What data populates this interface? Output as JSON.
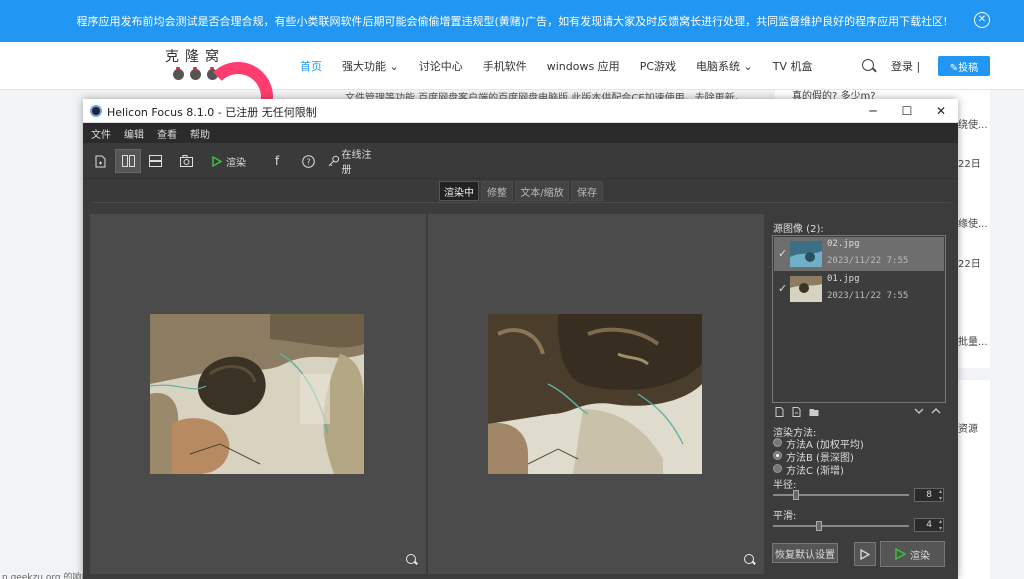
{
  "site": {
    "notice_text": "程序应用发布前均会测试是否合理合规，有些小类联网软件后期可能会偷偷增置违规型(黄赌)广告，如有发现请大家及时反馈窝长进行处理，共同监督维护良好的程序应用下载社区!",
    "logo_text": "克隆窝",
    "nav": [
      "首页",
      "强大功能 ⌄",
      "讨论中心",
      "手机软件",
      "windows 应用",
      "PC游戏",
      "电脑系统 ⌄",
      "TV 机盒"
    ],
    "login": "登录",
    "post": "✎投稿",
    "article_snippet": "文件管理等功能.百度网盘客户端的百度网盘电脑版,此版本供配合CE加速使用，去除更新。...",
    "right_question": "真的假的? 多少m?",
    "right_frag1": "绕使...",
    "right_frag2": "22日",
    "right_frag3": "缘使...",
    "right_frag4": "22日",
    "right_frag5": "批量...",
    "right_frag6": "资源",
    "bottom_url": "n.geekzu.org 的响应"
  },
  "window": {
    "title": "Helicon Focus 8.1.0 - 已注册  无任何限制",
    "menu": [
      "文件",
      "编辑",
      "查看",
      "帮助"
    ],
    "toolbar": {
      "render_label": "渲染",
      "register_label": "在线注册"
    },
    "tabs": [
      "渲染中",
      "修整",
      "文本/缩放",
      "保存"
    ],
    "source_label": "源图像 (2):",
    "sources": [
      {
        "name": "02.jpg",
        "date": "2023/11/22 7:55",
        "checked": "✓"
      },
      {
        "name": "01.jpg",
        "date": "2023/11/22 7:55",
        "checked": "✓"
      }
    ],
    "method_label": "渲染方法:",
    "methods": [
      "方法A (加权平均)",
      "方法B (景深图)",
      "方法C (渐增)"
    ],
    "selected_method": "方法B (景深图)",
    "radius_label": "半径:",
    "radius_value": "8",
    "radius_fraction": 0.17,
    "smooth_label": "平滑:",
    "smooth_value": "4",
    "smooth_fraction": 0.34,
    "reset_label": "恢复默认设置",
    "render_button": "渲染",
    "colors": {
      "accent": "#2196f3",
      "panel": "#3c3c3c",
      "play": "#3fbf3f"
    }
  }
}
